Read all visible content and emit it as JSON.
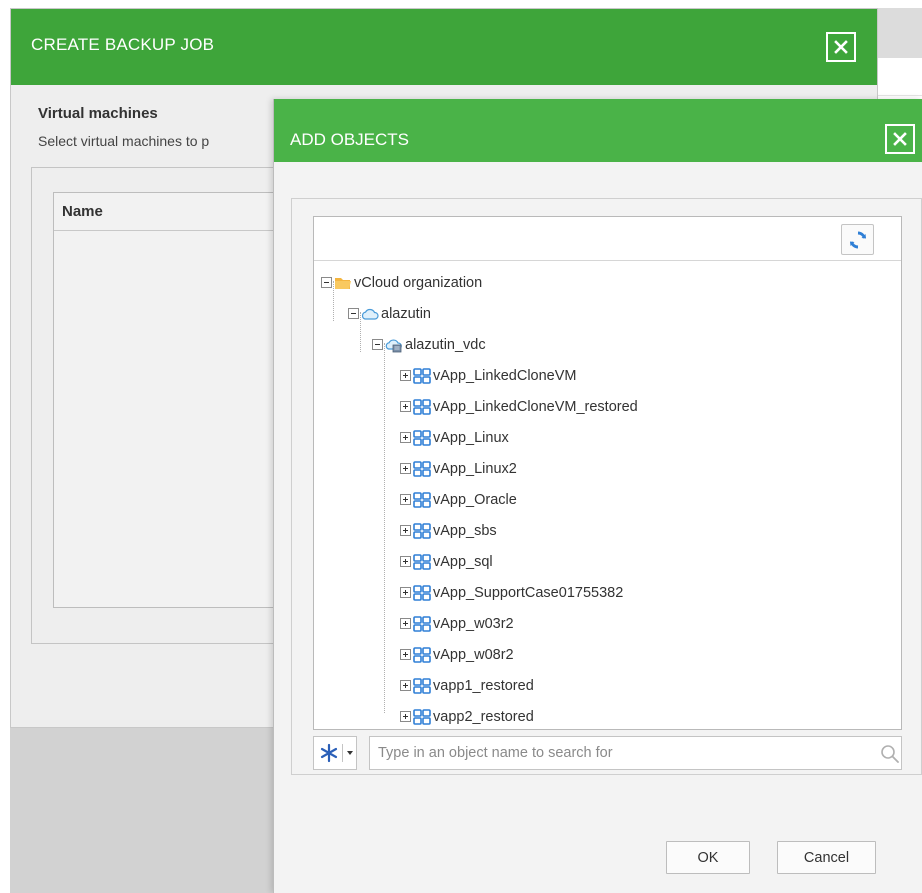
{
  "backup_job": {
    "title": "CREATE BACKUP JOB",
    "section_title": "Virtual machines",
    "section_desc": "Select virtual machines to p",
    "table": {
      "columns": [
        "Name"
      ]
    }
  },
  "add_objects": {
    "title": "ADD OBJECTS",
    "tree": [
      {
        "label": "vCloud organization",
        "type": "folder",
        "level": 0,
        "expanded": true
      },
      {
        "label": "alazutin",
        "type": "org",
        "level": 1,
        "expanded": true
      },
      {
        "label": "alazutin_vdc",
        "type": "vdc",
        "level": 2,
        "expanded": true
      },
      {
        "label": "vApp_LinkedCloneVM",
        "type": "vapp",
        "level": 3,
        "expanded": false
      },
      {
        "label": "vApp_LinkedCloneVM_restored",
        "type": "vapp",
        "level": 3,
        "expanded": false
      },
      {
        "label": "vApp_Linux",
        "type": "vapp",
        "level": 3,
        "expanded": false
      },
      {
        "label": "vApp_Linux2",
        "type": "vapp",
        "level": 3,
        "expanded": false
      },
      {
        "label": "vApp_Oracle",
        "type": "vapp",
        "level": 3,
        "expanded": false
      },
      {
        "label": "vApp_sbs",
        "type": "vapp",
        "level": 3,
        "expanded": false
      },
      {
        "label": "vApp_sql",
        "type": "vapp",
        "level": 3,
        "expanded": false
      },
      {
        "label": "vApp_SupportCase01755382",
        "type": "vapp",
        "level": 3,
        "expanded": false
      },
      {
        "label": "vApp_w03r2",
        "type": "vapp",
        "level": 3,
        "expanded": false
      },
      {
        "label": "vApp_w08r2",
        "type": "vapp",
        "level": 3,
        "expanded": false
      },
      {
        "label": "vapp1_restored",
        "type": "vapp",
        "level": 3,
        "expanded": false
      },
      {
        "label": "vapp2_restored",
        "type": "vapp",
        "level": 3,
        "expanded": false
      }
    ],
    "search": {
      "value": "",
      "placeholder": "Type in an object name to search for"
    },
    "filter_icon": "asterisk-icon",
    "ok_label": "OK",
    "cancel_label": "Cancel"
  },
  "colors": {
    "header_green": "#3ea53a",
    "dialog_green": "#4ab348",
    "icon_blue": "#2f7fd6",
    "folder_yellow": "#f4b53f"
  }
}
